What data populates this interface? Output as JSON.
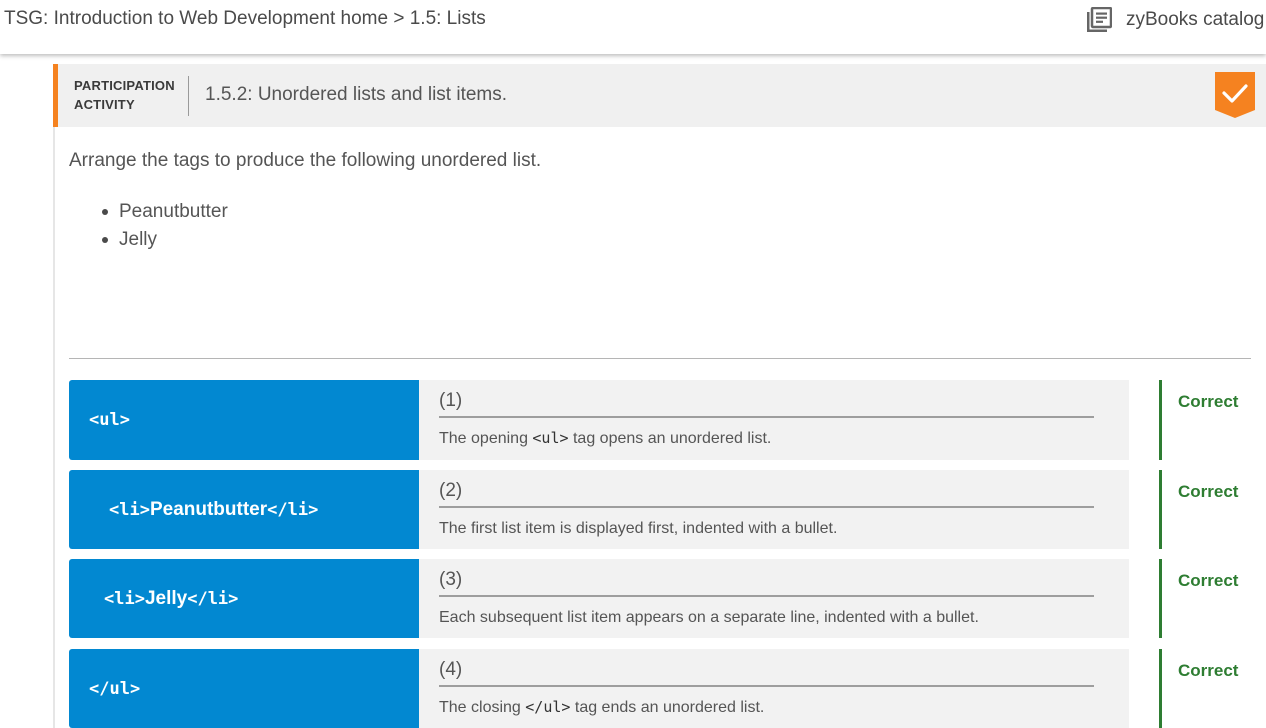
{
  "breadcrumb": "TSG: Introduction to Web Development home > 1.5: Lists",
  "catalog": {
    "icon": "library-books-icon",
    "label": "zyBooks catalog"
  },
  "activity": {
    "type_line1": "PARTICIPATION",
    "type_line2": "ACTIVITY",
    "title": "1.5.2: Unordered lists and list items.",
    "completed_icon": "check-icon",
    "accent_color": "#f58220"
  },
  "instructions": "Arrange the tags to produce the following unordered list.",
  "example_list": [
    "Peanutbutter",
    "Jelly"
  ],
  "rows": [
    {
      "tile_code_open": "<ul>",
      "tile_text": "",
      "tile_code_close": "",
      "number": "(1)",
      "desc_pre": "The opening ",
      "desc_code": "<ul>",
      "desc_post": " tag opens an unordered list.",
      "status": "Correct"
    },
    {
      "tile_code_open": "<li>",
      "tile_text": "Peanutbutter",
      "tile_code_close": "</li>",
      "number": "(2)",
      "desc_pre": "The first list item is displayed first, indented with a bullet.",
      "desc_code": "",
      "desc_post": "",
      "status": "Correct"
    },
    {
      "tile_code_open": "<li>",
      "tile_text": "Jelly",
      "tile_code_close": "</li>",
      "number": "(3)",
      "desc_pre": "Each subsequent list item appears on a separate line, indented with a bullet.",
      "desc_code": "",
      "desc_post": "",
      "status": "Correct"
    },
    {
      "tile_code_open": "</ul>",
      "tile_text": "",
      "tile_code_close": "",
      "number": "(4)",
      "desc_pre": "The closing ",
      "desc_code": "</ul>",
      "desc_post": " tag ends an unordered list.",
      "status": "Correct"
    }
  ],
  "colors": {
    "tile": "#0288d1",
    "correct": "#2e7d32",
    "slot": "#f2f2f2"
  }
}
